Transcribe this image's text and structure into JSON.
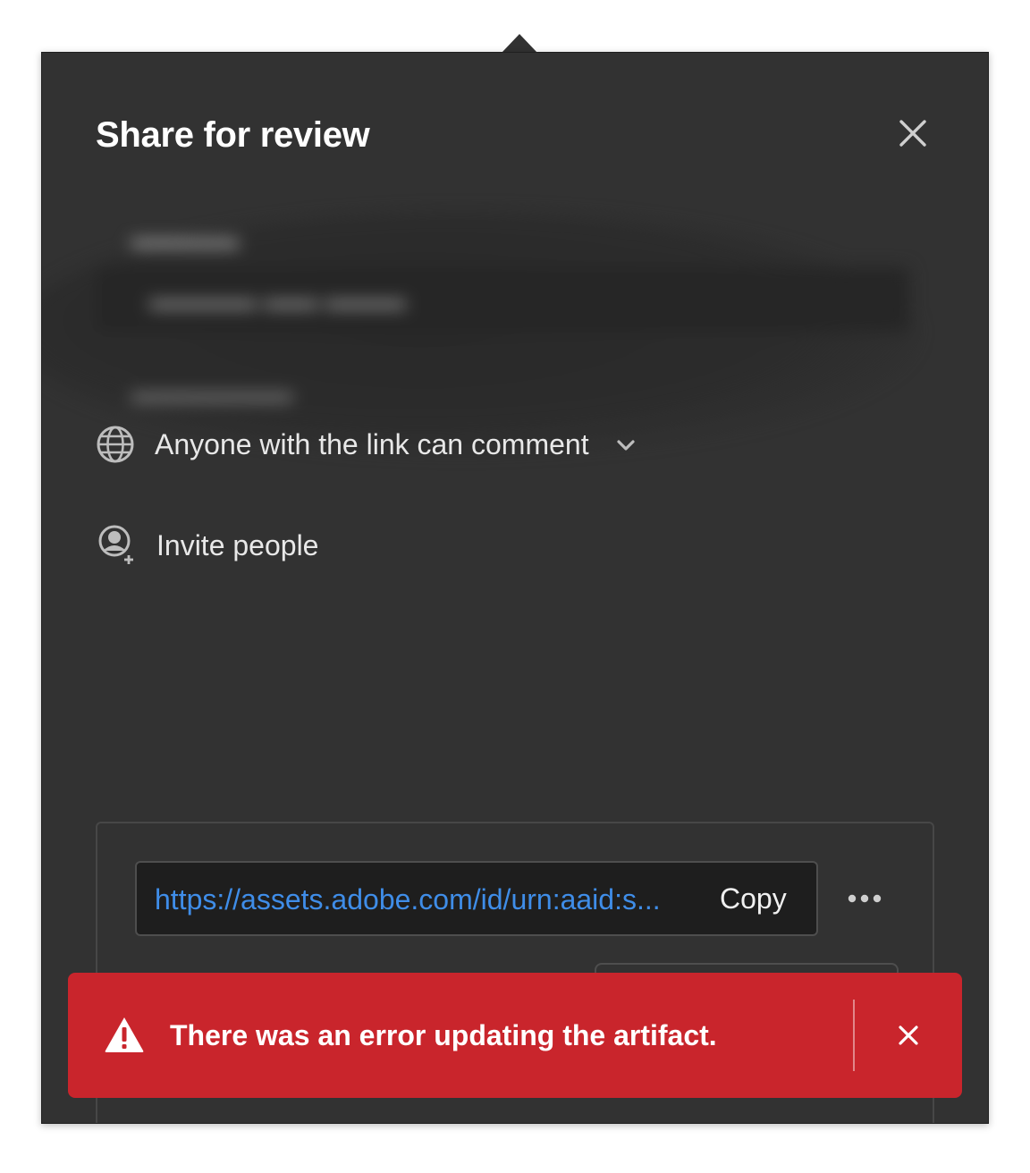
{
  "dialog": {
    "title": "Share for review",
    "close_icon": "close-icon"
  },
  "access": {
    "icon": "globe-icon",
    "label": "Anyone with the link can comment",
    "dropdown_icon": "chevron-down-icon"
  },
  "invite": {
    "icon": "add-user-icon",
    "label": "Invite people"
  },
  "share_link": {
    "url": "https://assets.adobe.com/id/urn:aaid:s...",
    "copy_label": "Copy",
    "more_icon": "more-icon"
  },
  "toast": {
    "variant": "error",
    "icon": "alert-icon",
    "message": "There was an error updating the artifact.",
    "close_icon": "close-icon"
  },
  "colors": {
    "panel_bg": "#323232",
    "link_blue": "#3f8de8",
    "error_red": "#c9252c"
  }
}
